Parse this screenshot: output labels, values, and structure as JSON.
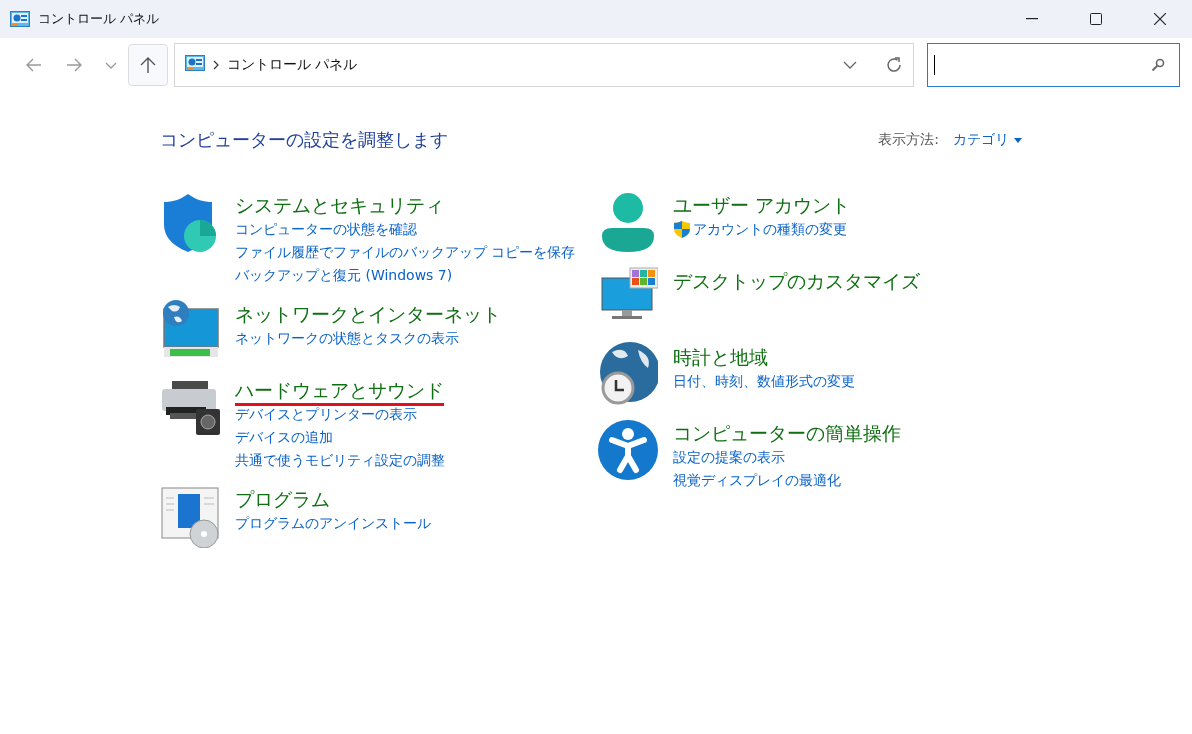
{
  "window": {
    "title": "コントロール パネル"
  },
  "address_bar": {
    "path": "コントロール パネル"
  },
  "heading": "コンピューターの設定を調整します",
  "view_by": {
    "label": "表示方法:",
    "value": "カテゴリ"
  },
  "columns": [
    [
      {
        "title": "システムとセキュリティ",
        "highlighted": false,
        "links": [
          {
            "text": "コンピューターの状態を確認",
            "shield": false
          },
          {
            "text": "ファイル履歴でファイルのバックアップ コピーを保存",
            "shield": false
          },
          {
            "text": "バックアップと復元 (Windows 7)",
            "shield": false
          }
        ]
      },
      {
        "title": "ネットワークとインターネット",
        "highlighted": false,
        "links": [
          {
            "text": "ネットワークの状態とタスクの表示",
            "shield": false
          }
        ]
      },
      {
        "title": "ハードウェアとサウンド",
        "highlighted": true,
        "links": [
          {
            "text": "デバイスとプリンターの表示",
            "shield": false
          },
          {
            "text": "デバイスの追加",
            "shield": false
          },
          {
            "text": "共通で使うモビリティ設定の調整",
            "shield": false
          }
        ]
      },
      {
        "title": "プログラム",
        "highlighted": false,
        "links": [
          {
            "text": "プログラムのアンインストール",
            "shield": false
          }
        ]
      }
    ],
    [
      {
        "title": "ユーザー アカウント",
        "highlighted": false,
        "links": [
          {
            "text": "アカウントの種類の変更",
            "shield": true
          }
        ]
      },
      {
        "title": "デスクトップのカスタマイズ",
        "highlighted": false
      },
      {
        "title": "時計と地域",
        "highlighted": false,
        "links": [
          {
            "text": "日付、時刻、数値形式の変更",
            "shield": false
          }
        ]
      },
      {
        "title": "コンピューターの簡単操作",
        "highlighted": false,
        "links": [
          {
            "text": "設定の提案の表示",
            "shield": false
          },
          {
            "text": "視覚ディスプレイの最適化",
            "shield": false
          }
        ]
      }
    ]
  ]
}
